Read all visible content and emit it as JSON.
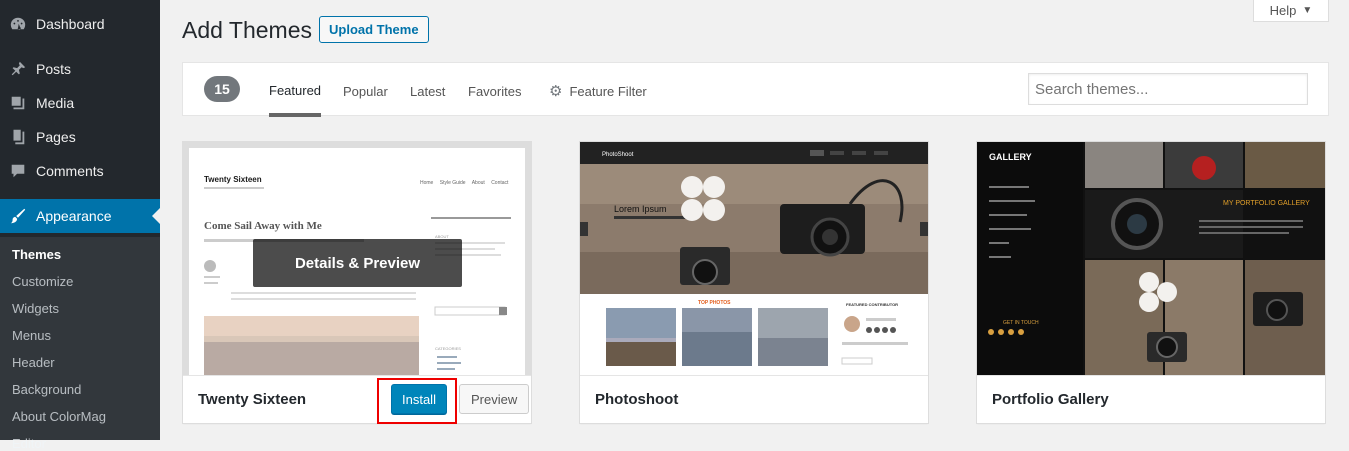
{
  "sidebar": {
    "items": [
      {
        "label": "Dashboard",
        "icon": "dashboard-icon"
      },
      {
        "label": "Posts",
        "icon": "pin-icon"
      },
      {
        "label": "Media",
        "icon": "media-icon"
      },
      {
        "label": "Pages",
        "icon": "pages-icon"
      },
      {
        "label": "Comments",
        "icon": "comment-icon"
      },
      {
        "label": "Appearance",
        "icon": "brush-icon"
      }
    ],
    "submenu": [
      {
        "label": "Themes"
      },
      {
        "label": "Customize"
      },
      {
        "label": "Widgets"
      },
      {
        "label": "Menus"
      },
      {
        "label": "Header"
      },
      {
        "label": "Background"
      },
      {
        "label": "About ColorMag"
      },
      {
        "label": "Editor"
      }
    ]
  },
  "header": {
    "title": "Add Themes",
    "upload_label": "Upload Theme",
    "help_label": "Help"
  },
  "filters": {
    "count": "15",
    "tabs": [
      {
        "label": "Featured"
      },
      {
        "label": "Popular"
      },
      {
        "label": "Latest"
      },
      {
        "label": "Favorites"
      },
      {
        "label": "Feature Filter"
      }
    ],
    "search_placeholder": "Search themes..."
  },
  "themes": [
    {
      "name": "Twenty Sixteen",
      "install_label": "Install",
      "preview_label": "Preview",
      "overlay_label": "Details & Preview",
      "shot": {
        "site_title": "Twenty Sixteen",
        "nav": [
          "Home",
          "Style Guide",
          "About",
          "Contact"
        ],
        "post_title": "Come Sail Away with Me",
        "sidebar_about": "ABOUT",
        "sidebar_categories": "CATEGORIES"
      }
    },
    {
      "name": "Photoshoot",
      "shot": {
        "brand": "PhotoShoot",
        "hero_text": "Lorem Ipsum",
        "top_photos": "TOP PHOTOS",
        "featured": "FEATURED CONTRIBUTOR"
      }
    },
    {
      "name": "Portfolio Gallery",
      "shot": {
        "logo": "GALLERY",
        "headline": "MY PORTFOLIO GALLERY",
        "contact": "GET IN TOUCH"
      }
    }
  ],
  "colors": {
    "sidebar_bg": "#23282d",
    "active_bg": "#0073aa",
    "install_bg": "#0085ba",
    "highlight_border": "#ee0000"
  }
}
